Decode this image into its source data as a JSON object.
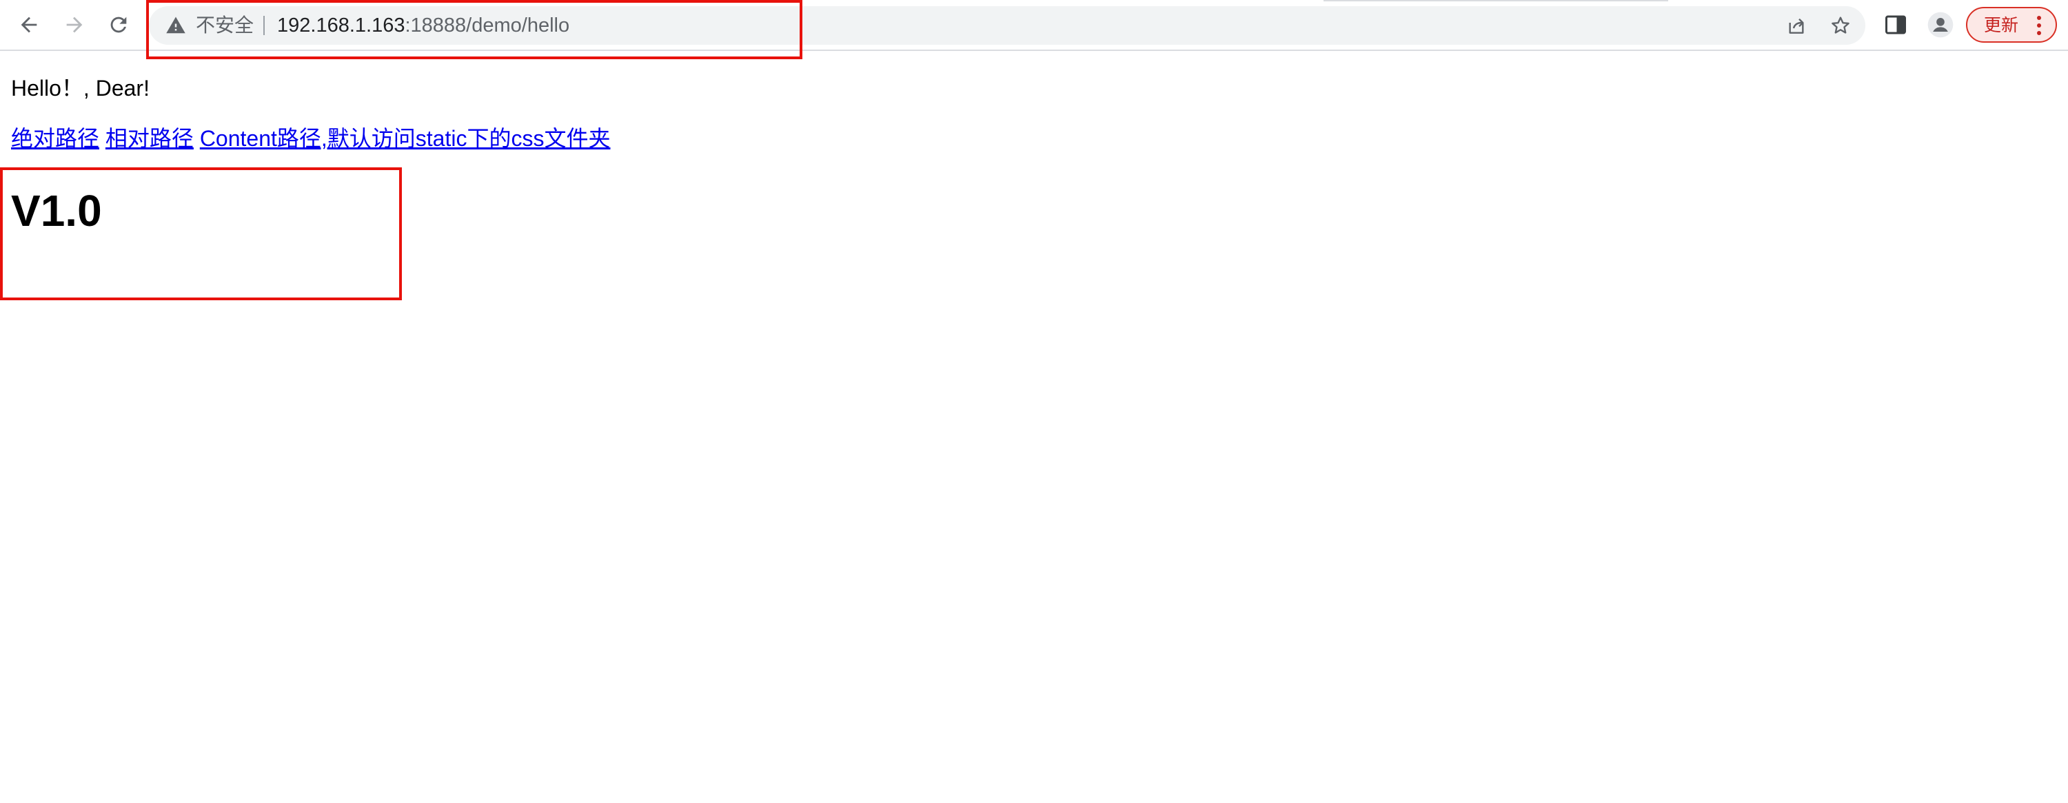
{
  "browser": {
    "address_bar": {
      "security_label": "不安全",
      "url_host": "192.168.1.163",
      "url_rest": ":18888/demo/hello"
    },
    "update_button_label": "更新",
    "icons": {
      "back": "arrow-left-icon",
      "forward": "arrow-right-icon",
      "reload": "reload-icon",
      "warning": "warning-triangle-icon",
      "share": "share-icon",
      "bookmark": "star-icon",
      "side_panel": "side-panel-icon",
      "profile": "profile-icon",
      "menu": "kebab-menu-icon"
    },
    "colors": {
      "accent_red": "#d93025",
      "link_blue": "#0000ee",
      "annotation_red": "#e8120c"
    }
  },
  "page": {
    "greeting": "Hello！, Dear!",
    "links": [
      {
        "label": "绝对路径"
      },
      {
        "label": "相对路径"
      },
      {
        "label": "Content路径,默认访问static下的css文件夹"
      }
    ],
    "version": "V1.0"
  }
}
